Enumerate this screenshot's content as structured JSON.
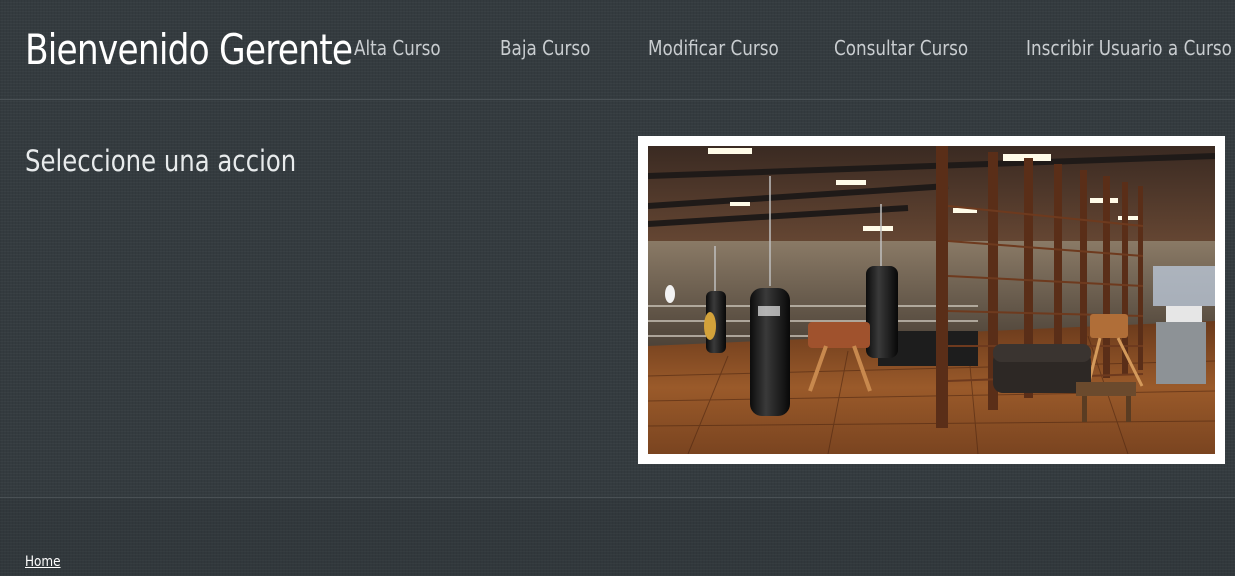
{
  "header": {
    "title": "Bienvenido Gerente",
    "nav": {
      "alta": "Alta Curso",
      "baja": "Baja Curso",
      "modificar": "Modificar Curso",
      "consultar": "Consultar Curso",
      "inscribir": "Inscribir Usuario a Curso"
    }
  },
  "main": {
    "heading": "Seleccione una accion",
    "image": {
      "subject": "boxing-gym-photo"
    }
  },
  "footer": {
    "home_link": "Home"
  },
  "colors": {
    "background": "#343b3f",
    "nav_text": "#c9cdd0",
    "title_text": "#ffffff",
    "photo_border": "#ffffff"
  }
}
